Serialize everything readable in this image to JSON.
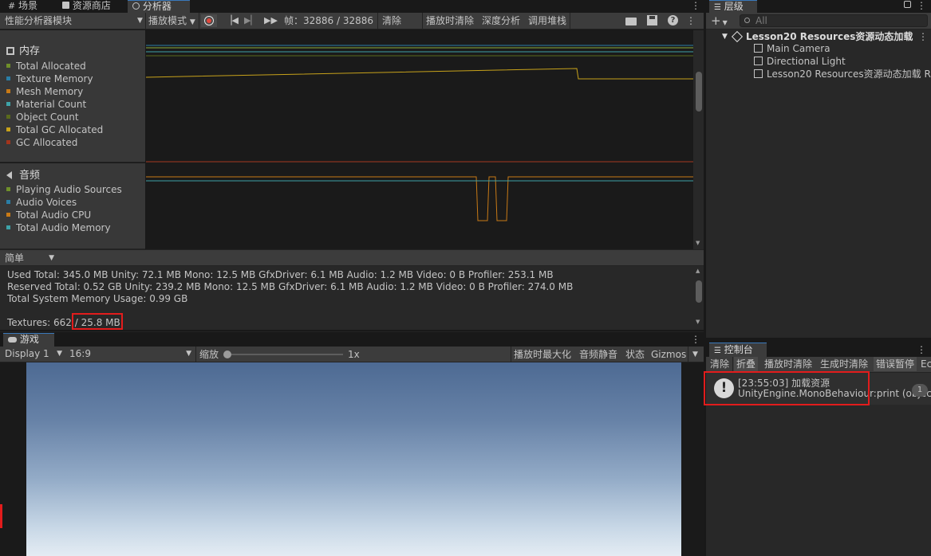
{
  "tabs_left": [
    {
      "label": "场景",
      "icon": "grid-icon"
    },
    {
      "label": "资源商店",
      "icon": "store-icon"
    },
    {
      "label": "分析器",
      "icon": "profiler-icon"
    }
  ],
  "profiler_toolbar": {
    "modules_dropdown": "性能分析器模块",
    "play_mode_dropdown": "播放模式",
    "frame_label": "帧：32886 / 32886",
    "clear": "清除",
    "clear_on_play": "播放时清除",
    "deep_profile": "深度分析",
    "call_stacks": "调用堆栈"
  },
  "memory_module": {
    "title": "内存",
    "legend": [
      {
        "label": "Total Allocated",
        "color": "#6f8f2a"
      },
      {
        "label": "Texture Memory",
        "color": "#2a7ea6"
      },
      {
        "label": "Mesh Memory",
        "color": "#c87a16"
      },
      {
        "label": "Material Count",
        "color": "#3ea3a8"
      },
      {
        "label": "Object Count",
        "color": "#5a6a1c"
      },
      {
        "label": "Total GC Allocated",
        "color": "#c7a21a"
      },
      {
        "label": "GC Allocated",
        "color": "#a3341c"
      }
    ]
  },
  "audio_module": {
    "title": "音频",
    "legend": [
      {
        "label": "Playing Audio Sources",
        "color": "#6f8f2a"
      },
      {
        "label": "Audio Voices",
        "color": "#2a7ea6"
      },
      {
        "label": "Total Audio CPU",
        "color": "#c87a16"
      },
      {
        "label": "Total Audio Memory",
        "color": "#3ea3a8"
      }
    ]
  },
  "details": {
    "view_dropdown": "简单",
    "used_total": "Used Total: 345.0 MB   Unity: 72.1 MB   Mono: 12.5 MB   GfxDriver: 6.1 MB   Audio: 1.2 MB   Video: 0 B   Profiler: 253.1 MB",
    "reserved_total": "Reserved Total: 0.52 GB   Unity: 239.2 MB   Mono: 12.5 MB   GfxDriver: 6.1 MB   Audio: 1.2 MB   Video: 0 B   Profiler: 274.0 MB",
    "system_usage": "Total System Memory Usage: 0.99 GB",
    "textures_prefix": "Textures: 662",
    "textures_size": "/ 25.8 MB"
  },
  "game_view": {
    "tab": "游戏",
    "display": "Display 1",
    "aspect": "16:9",
    "scale_label": "缩放",
    "scale_value": "1x",
    "maximize_on_play": "播放时最大化",
    "mute_audio": "音频静音",
    "stats": "状态",
    "gizmos": "Gizmos"
  },
  "hierarchy": {
    "tab": "层级",
    "search_placeholder": "All",
    "scene": "Lesson20 Resources资源动态加载",
    "items": [
      "Main Camera",
      "Directional Light",
      "Lesson20 Resources资源动态加载 R"
    ]
  },
  "console": {
    "tab": "控制台",
    "buttons": [
      "清除",
      "折叠",
      "播放时清除",
      "生成时清除",
      "错误暂停",
      "Ec"
    ],
    "entry_line1": "[23:55:03] 加载资源",
    "entry_line2": "UnityEngine.MonoBehaviour:print (object)",
    "entry_count": "1"
  },
  "colors": {
    "accent_red": "#e21c1c",
    "panel_bg": "#282828",
    "toolbar_bg": "#3c3c3c"
  }
}
